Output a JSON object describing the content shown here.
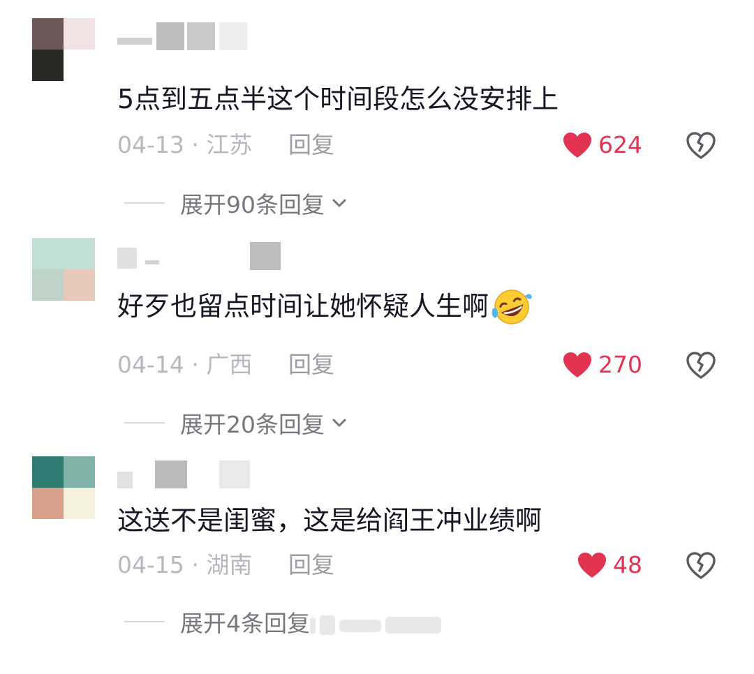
{
  "comments": [
    {
      "text": "5点到五点半这个时间段怎么没安排上",
      "date": "04-13",
      "location": "江苏",
      "reply_label": "回复",
      "likes": "624",
      "expand_label": "展开90条回复",
      "avatar_colors": [
        "#6b5955",
        "#f1e3e4",
        "#2a2823",
        "#ffffff"
      ]
    },
    {
      "text": "好歹也留点时间让她怀疑人生啊",
      "emoji": "rolling-on-floor-laughing",
      "date": "04-14",
      "location": "广西",
      "reply_label": "回复",
      "likes": "270",
      "expand_label": "展开20条回复",
      "avatar_colors": [
        "#c2dfd6",
        "#c2dfd6",
        "#bfd2c8",
        "#e8c8b9"
      ]
    },
    {
      "text": "这送不是闺蜜，这是给阎王冲业绩啊",
      "date": "04-15",
      "location": "湖南",
      "reply_label": "回复",
      "likes": "48",
      "expand_label": "展开4条回复",
      "avatar_colors": [
        "#2f7d72",
        "#7fb3a8",
        "#d6a08a",
        "#f5f1dc"
      ]
    }
  ],
  "separator": "·",
  "colors": {
    "text": "#161823",
    "meta": "#b7b8bd",
    "like": "#e23353",
    "expand": "#77787d"
  },
  "icons": [
    "heart-icon",
    "broken-heart-icon",
    "chevron-down-icon"
  ]
}
